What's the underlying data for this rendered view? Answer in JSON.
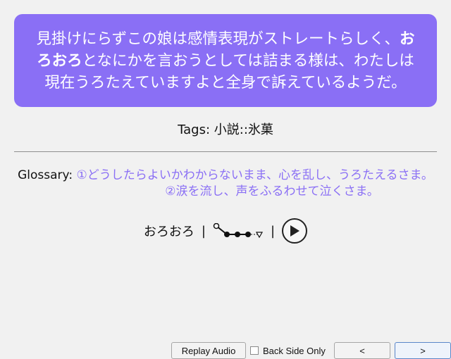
{
  "card": {
    "text_before": "見掛けにらずこの娘は感情表現がストレートらしく、",
    "bold_word": "おろおろ",
    "text_after": "となにかを言おうとしては詰まる様は、わたしは現在うろたえていますよと全身で訴えているようだ。",
    "background": "#8a6ff5"
  },
  "tags": {
    "label": "Tags:",
    "value": "小説::氷菓"
  },
  "glossary": {
    "label": "Glossary:",
    "line1": "①どうしたらよいかわからないまま、心を乱し、うろたえるさま。",
    "line2": "②涙を流し、声をふるわせて泣くさま。",
    "accent": "#8a6ff5"
  },
  "pitch": {
    "word": "おろおろ",
    "separator": "|",
    "icon": "pitch-accent-graph",
    "audio_icon": "play-icon"
  },
  "bottom": {
    "replay_label": "Replay Audio",
    "back_side_label": "Back Side Only",
    "back_side_checked": false,
    "prev_label": "<",
    "next_label": ">"
  }
}
